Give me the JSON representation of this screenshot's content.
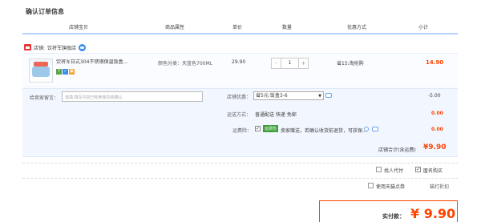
{
  "page": {
    "title": "确认订单信息"
  },
  "table_headers": [
    "店铺宝贝",
    "商品属性",
    "单价",
    "数量",
    "优惠方式",
    "小计"
  ],
  "shop": {
    "label": "店铺:",
    "name": "饮将军旗舰店",
    "wangwang_icon": "wangwang-chat-icon"
  },
  "item": {
    "name": "饮将军日式304不锈钢保温饭盒...",
    "property": "颜色分类：天蓝色700ML",
    "unit_price": "29.90",
    "quantity": "1",
    "qty_minus": "-",
    "qty_plus": "+",
    "promo": "省15:淘抢购",
    "subtotal": "14.90",
    "badges": [
      "7",
      "✓",
      "▣"
    ]
  },
  "buyer_message": {
    "label": "给卖家留言：",
    "placeholder": "选填:填写内容已和卖家协商确认"
  },
  "shop_promo": {
    "label": "店铺优惠：",
    "selected": "省5元:饭盒3-6",
    "amount": "-5.00"
  },
  "shipping": {
    "label": "运送方式：",
    "value": "普通配送 快递 免邮",
    "amount": "0.00"
  },
  "insurance": {
    "label": "运费险：",
    "tag": "运费险",
    "text": "卖家赠送，若确认收货前退货，可获保...",
    "amount": "0.00"
  },
  "shop_total": {
    "label": "店铺合计(含运费)",
    "amount": "¥9.90"
  },
  "options": {
    "anonymous_buy": "匿名购买",
    "pay_for_others": "找人代付",
    "tmall_points": "使用天猫点券",
    "tmall_points_link": "猫打折扣"
  },
  "payment": {
    "label": "实付款：",
    "amount": "¥ 9.90"
  },
  "colors": {
    "accent": "#ff4400",
    "header_border": "#b2d1ff",
    "detail_bg": "#f2f7ff"
  }
}
